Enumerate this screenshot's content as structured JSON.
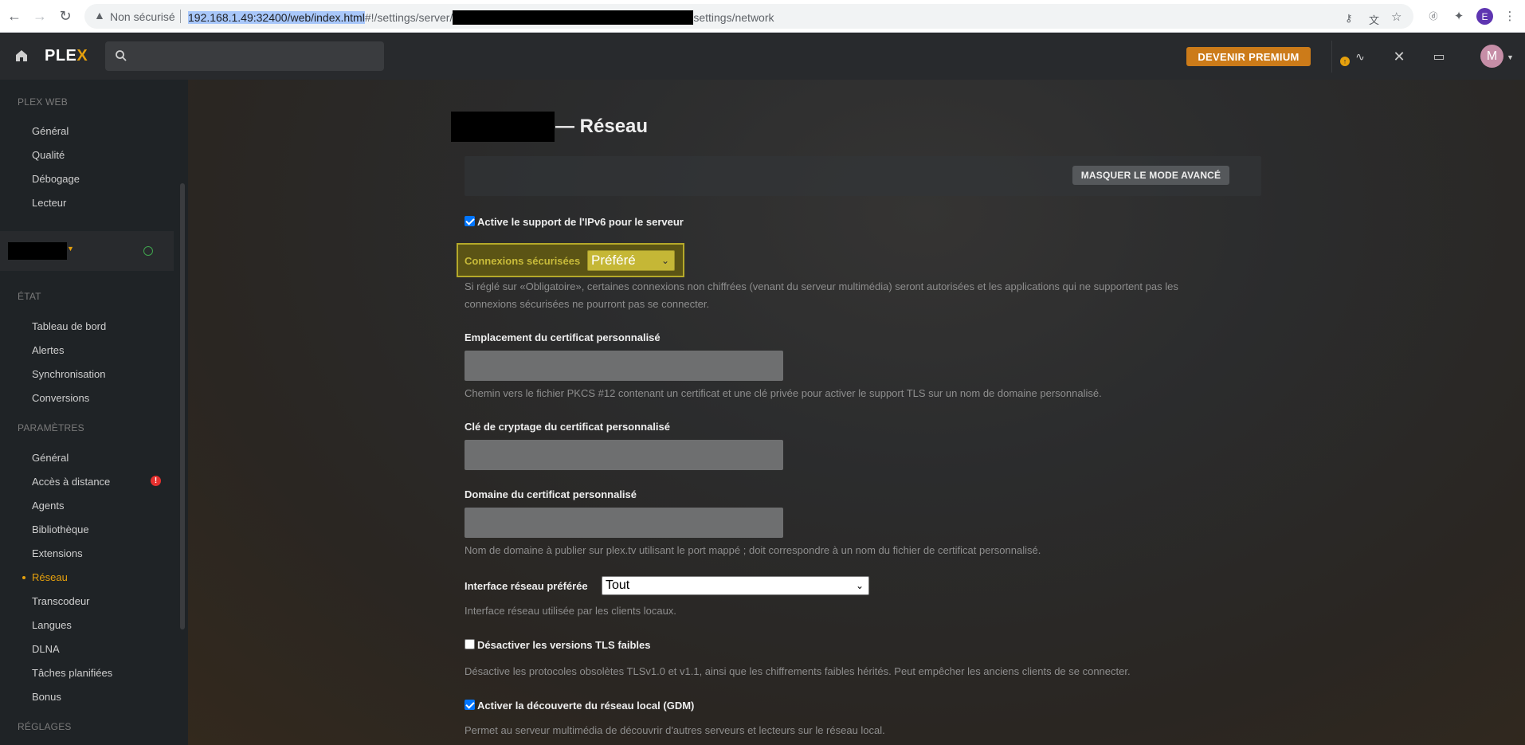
{
  "browser": {
    "security_label": "Non sécurisé",
    "url_host": "192.168.1.49:32400/web/index.html",
    "url_path_prefix": "#!/settings/server/",
    "url_path_suffix": "settings/network",
    "profile_initial": "E"
  },
  "topbar": {
    "logo_text": "PLE",
    "logo_x": "X",
    "premium_label": "DEVENIR PREMIUM",
    "avatar_initial": "M"
  },
  "sidebar": {
    "plex_web_title": "PLEX WEB",
    "plex_web_items": [
      "Général",
      "Qualité",
      "Débogage",
      "Lecteur"
    ],
    "etat_title": "ÉTAT",
    "etat_items": [
      "Tableau de bord",
      "Alertes",
      "Synchronisation",
      "Conversions"
    ],
    "params_title": "PARAMÈTRES",
    "params_items": [
      "Général",
      "Accès à distance",
      "Agents",
      "Bibliothèque",
      "Extensions",
      "Réseau",
      "Transcodeur",
      "Langues",
      "DLNA",
      "Tâches planifiées",
      "Bonus"
    ],
    "reglages_title": "RÉGLAGES",
    "alert_badge": "!"
  },
  "main": {
    "title": "— Réseau",
    "advanced_button": "MASQUER LE MODE AVANCÉ",
    "ipv6_label": "Active le support de l'IPv6 pour le serveur",
    "secure_label": "Connexions sécurisées",
    "secure_value": "Préféré",
    "secure_help_1": "Si réglé sur «Obligatoire», certaines connexions non chiffrées (venant du serveur multimédia) seront autorisées et les applications qui ne supportent pas les",
    "secure_help_2": "connexions sécurisées ne pourront pas se connecter.",
    "cert_location_label": "Emplacement du certificat personnalisé",
    "cert_location_help": "Chemin vers le fichier PKCS #12 contenant un certificat et une clé privée pour activer le support TLS sur un nom de domaine personnalisé.",
    "cert_key_label": "Clé de cryptage du certificat personnalisé",
    "cert_domain_label": "Domaine du certificat personnalisé",
    "cert_domain_help": "Nom de domaine à publier sur plex.tv utilisant le port mappé ; doit correspondre à un nom du fichier de certificat personnalisé.",
    "iface_label": "Interface réseau préférée",
    "iface_value": "Tout",
    "iface_help": "Interface réseau utilisée par les clients locaux.",
    "tls_label": "Désactiver les versions TLS faibles",
    "tls_help": "Désactive les protocoles obsolètes TLSv1.0 et v1.1, ainsi que les chiffrements faibles hérités. Peut empêcher les anciens clients de se connecter.",
    "gdm_label": "Activer la découverte du réseau local (GDM)",
    "gdm_help": "Permet au serveur multimédia de découvrir d'autres serveurs et lecteurs sur le réseau local."
  }
}
